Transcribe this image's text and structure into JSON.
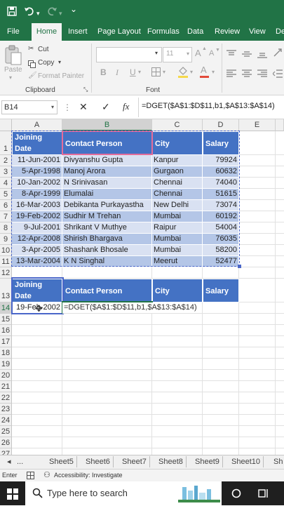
{
  "tabs": [
    "File",
    "Home",
    "Insert",
    "Page Layout",
    "Formulas",
    "Data",
    "Review",
    "View",
    "Dev"
  ],
  "active_tab": "Home",
  "ribbon": {
    "paste_label": "Paste",
    "cut_label": "Cut",
    "copy_label": "Copy",
    "format_painter_label": "Format Painter",
    "clipboard_group": "Clipboard",
    "font_group": "Font",
    "font_size": "11",
    "bold": "B",
    "italic": "I",
    "underline": "U",
    "grow_font": "A",
    "shrink_font": "A",
    "font_color": "A"
  },
  "formula_bar": {
    "name_box": "B14",
    "fx": "fx",
    "formula": "=DGET($A$1:$D$11,b1,$A$13:$A$14)"
  },
  "columns": [
    "A",
    "B",
    "C",
    "D",
    "E"
  ],
  "table1": {
    "headers": [
      "Joining Date",
      "Contact Person",
      "City",
      "Salary"
    ],
    "rows": [
      [
        "11-Jun-2001",
        "Divyanshu Gupta",
        "Kanpur",
        "79924"
      ],
      [
        "5-Apr-1998",
        "Manoj Arora",
        "Gurgaon",
        "60632"
      ],
      [
        "10-Jan-2002",
        "N Srinivasan",
        "Chennai",
        "74040"
      ],
      [
        "8-Apr-1999",
        "Elumalai",
        "Chennai",
        "51615"
      ],
      [
        "16-Mar-2003",
        "Debikanta Purkayastha",
        "New Delhi",
        "73074"
      ],
      [
        "19-Feb-2002",
        "Sudhir M Trehan",
        "Mumbai",
        "60192"
      ],
      [
        "9-Jul-2001",
        "Shrikant V Muthye",
        "Raipur",
        "54004"
      ],
      [
        "12-Apr-2008",
        "Shirish Bhargava",
        "Mumbai",
        "76035"
      ],
      [
        "3-Apr-2005",
        "Shashank Bhosale",
        "Mumbai",
        "58200"
      ],
      [
        "13-Mar-2004",
        "K N Singhal",
        "Meerut",
        "52477"
      ]
    ]
  },
  "table2": {
    "headers": [
      "Joining Date",
      "Contact Person",
      "City",
      "Salary"
    ],
    "criteria_value": "19-Feb-2002",
    "editing_formula": "=DGET($A$1:$D$11,b1,$A$13:$A$14)"
  },
  "row_numbers": [
    "1",
    "2",
    "3",
    "4",
    "5",
    "6",
    "7",
    "8",
    "9",
    "10",
    "11",
    "12",
    "13",
    "14",
    "15",
    "16",
    "17",
    "18",
    "19",
    "20",
    "21",
    "22",
    "23",
    "24",
    "25",
    "26",
    "27"
  ],
  "sheet_tabs": [
    "...",
    "Sheet5",
    "Sheet6",
    "Sheet7",
    "Sheet8",
    "Sheet9",
    "Sheet10",
    "Sh"
  ],
  "status": {
    "mode": "Enter",
    "accessibility": "Accessibility: Investigate"
  },
  "taskbar": {
    "search_placeholder": "Type here to search"
  },
  "colors": {
    "excel_green": "#217346",
    "header_blue": "#4472c4",
    "band_light": "#d9e1f2",
    "band_dark": "#b4c6e7",
    "selection_pink": "#e46c9a"
  }
}
